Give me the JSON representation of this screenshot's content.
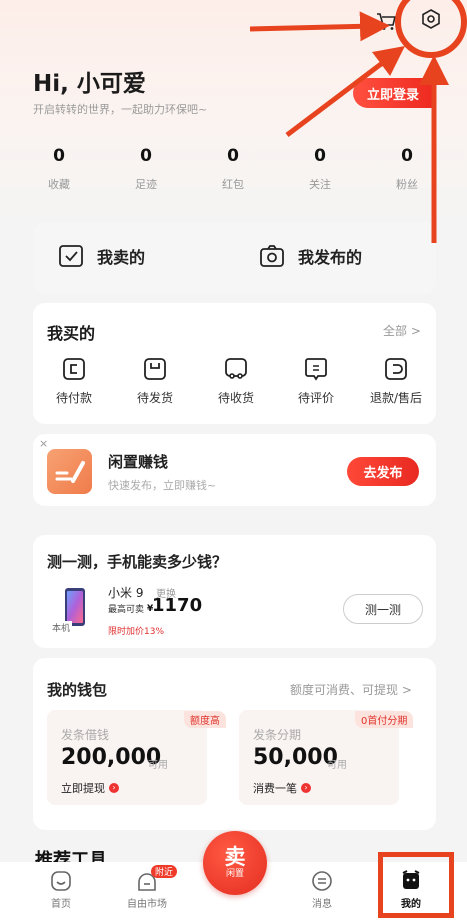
{
  "header": {
    "greeting": "Hi, 小可爱",
    "subtitle": "开启转转的世界，一起助力环保吧~",
    "login_label": "立即登录"
  },
  "stats": [
    {
      "value": "0",
      "label": "收藏"
    },
    {
      "value": "0",
      "label": "足迹"
    },
    {
      "value": "0",
      "label": "红包"
    },
    {
      "value": "0",
      "label": "关注"
    },
    {
      "value": "0",
      "label": "粉丝"
    }
  ],
  "sell": {
    "my_sold": "我卖的",
    "my_published": "我发布的"
  },
  "bought": {
    "title": "我买的",
    "all_label": "全部 >",
    "items": [
      "待付款",
      "待发货",
      "待收货",
      "待评价",
      "退款/售后"
    ]
  },
  "idle": {
    "close": "×",
    "title": "闲置赚钱",
    "subtitle": "快速发布，立即赚钱~",
    "button": "去发布"
  },
  "test": {
    "title": "测一测，手机能卖多少钱？",
    "local_tag": "本机",
    "phone_name": "小米 9",
    "change": "更换",
    "max_sell": "最高可卖",
    "currency": "¥",
    "price": "1170",
    "limit": "限时加价13%",
    "button": "测一测"
  },
  "wallet": {
    "title": "我的钱包",
    "link": "额度可消费、可提现 >",
    "cards": [
      {
        "badge": "额度高",
        "name": "发条借钱",
        "amount": "200,000",
        "avail": "可用",
        "action": "立即提现"
      },
      {
        "badge": "0首付分期",
        "name": "发条分期",
        "amount": "50,000",
        "avail": "可用",
        "action": "消费一笔"
      }
    ]
  },
  "recommend": {
    "title": "推荐工具"
  },
  "nav": {
    "home": "首页",
    "market": "自由市场",
    "near_badge": "附近",
    "sell_big": "卖",
    "sell_small": "闲置",
    "messages": "消息",
    "mine": "我的"
  },
  "colors": {
    "accent": "#e8301f",
    "annotation": "#e8431f"
  }
}
